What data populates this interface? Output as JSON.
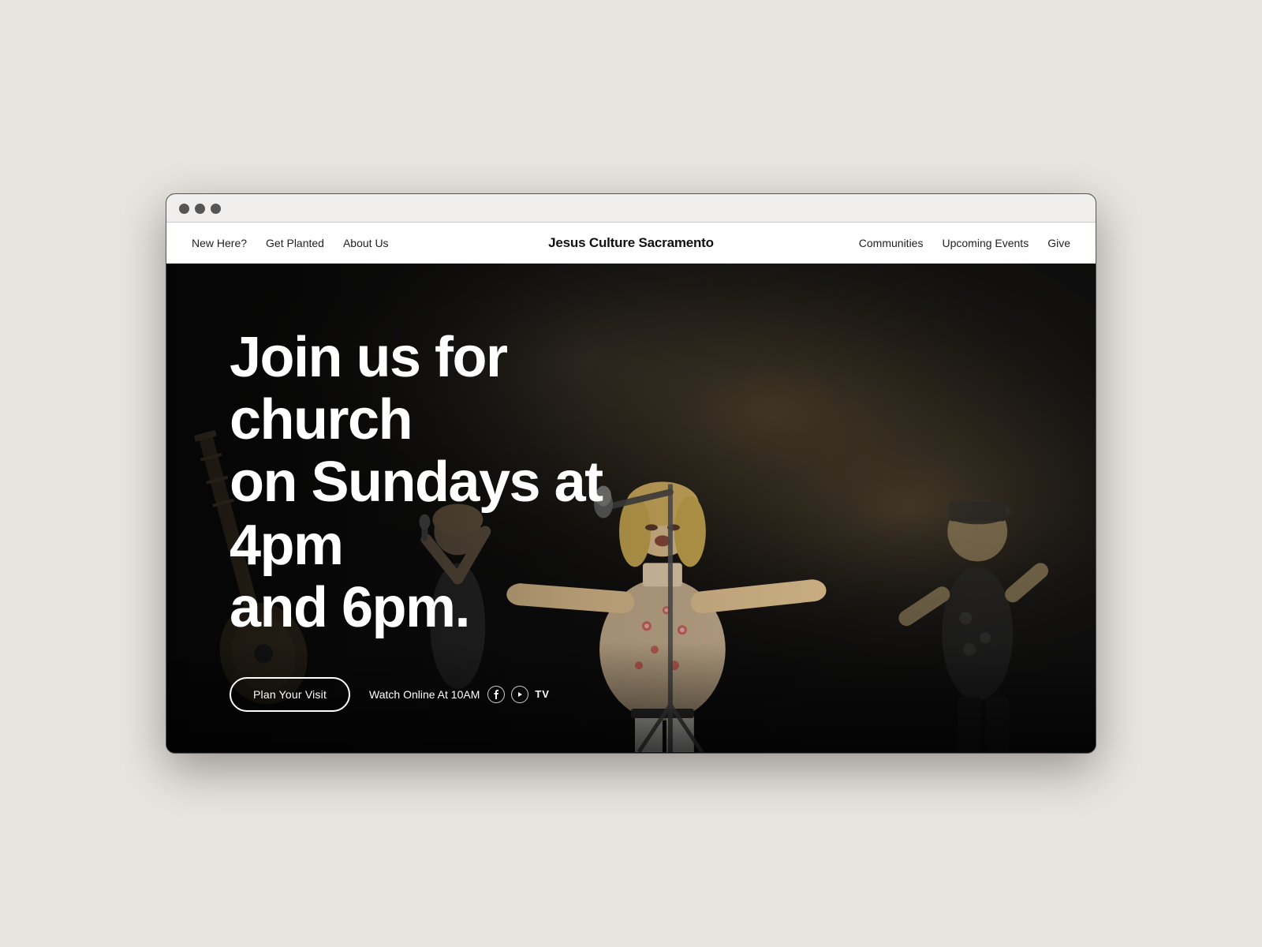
{
  "browser": {
    "bg_color": "#e8e4de"
  },
  "nav": {
    "left_links": [
      {
        "label": "New Here?",
        "id": "new-here"
      },
      {
        "label": "Get Planted",
        "id": "get-planted"
      },
      {
        "label": "About Us",
        "id": "about-us"
      }
    ],
    "brand": "Jesus Culture Sacramento",
    "right_links": [
      {
        "label": "Communities",
        "id": "communities"
      },
      {
        "label": "Upcoming Events",
        "id": "upcoming-events"
      },
      {
        "label": "Give",
        "id": "give"
      }
    ]
  },
  "hero": {
    "heading_line1": "Join us for church",
    "heading_line2": "on Sundays at 4pm",
    "heading_line3": "and 6pm.",
    "plan_visit_label": "Plan Your Visit",
    "watch_online_label": "Watch Online At 10AM",
    "tv_label": "TV",
    "facebook_icon": "f",
    "youtube_icon": "▶"
  }
}
